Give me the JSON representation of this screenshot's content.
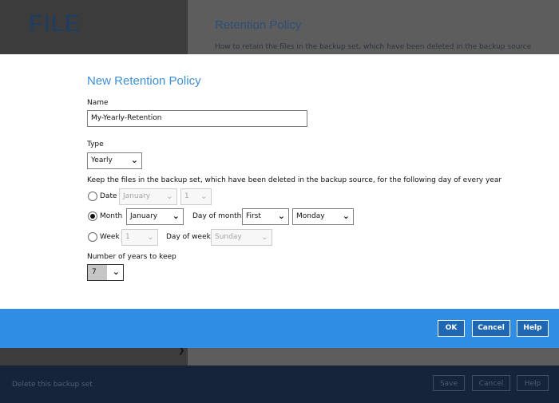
{
  "background": {
    "app_title": "FILE",
    "section_heading": "Retention Policy",
    "section_desc": "How to retain the files in the backup set, which have been deleted in the backup source",
    "hidden_field_text": "",
    "delete_link": "Delete this backup set",
    "save_label": "Save",
    "cancel_label": "Cancel",
    "help_label": "Help"
  },
  "modal": {
    "title": "New Retention Policy",
    "name_label": "Name",
    "name_value": "My-Yearly-Retention",
    "type_label": "Type",
    "type_value": "Yearly",
    "keep_desc": "Keep the files in the backup set, which have been deleted in the backup source, for the following day of every year",
    "date_option": {
      "label": "Date",
      "selected": false,
      "month_value": "January",
      "day_value": "1"
    },
    "month_option": {
      "label": "Month",
      "selected": true,
      "month_value": "January",
      "day_of_month_label": "Day of month",
      "day_of_month_value": "First",
      "weekday_value": "Monday"
    },
    "week_option": {
      "label": "Week",
      "selected": false,
      "week_value": "1",
      "day_of_week_label": "Day of week",
      "day_of_week_value": "Sunday"
    },
    "years_label": "Number of years to keep",
    "years_value": "7",
    "ok_label": "OK",
    "cancel_label": "Cancel",
    "help_label": "Help"
  },
  "colors": {
    "accent": "#2f8ee3",
    "title_blue": "#3d8fd4",
    "footer_dark": "#15243a"
  }
}
